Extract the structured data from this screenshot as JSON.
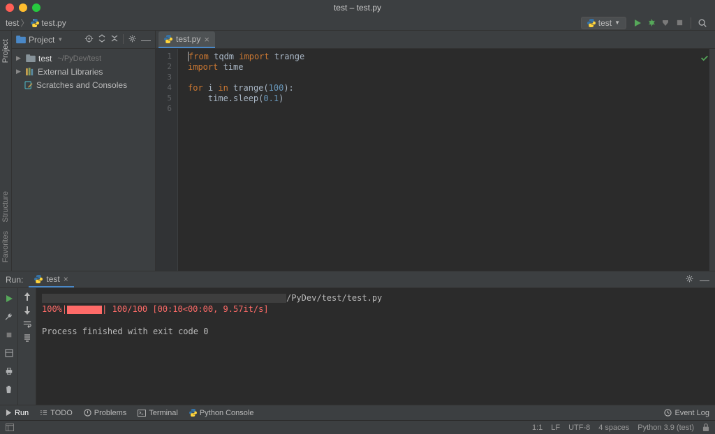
{
  "window": {
    "title": "test – test.py"
  },
  "breadcrumb": {
    "project": "test",
    "file": "test.py"
  },
  "run_config": {
    "name": "test"
  },
  "project_panel": {
    "title": "Project",
    "tree": {
      "root": "test",
      "root_path": "~/PyDev/test",
      "external": "External Libraries",
      "scratches": "Scratches and Consoles"
    }
  },
  "left_strip": {
    "project": "Project",
    "structure": "Structure",
    "favorites": "Favorites"
  },
  "editor": {
    "tab": "test.py",
    "lines": [
      "1",
      "2",
      "3",
      "4",
      "5",
      "6"
    ],
    "code": {
      "l1_from": "from",
      "l1_mod": " tqdm ",
      "l1_import": "import",
      "l1_name": " trange",
      "l2_import": "import",
      "l2_mod": " time",
      "l4_for": "for",
      "l4_var": " i ",
      "l4_in": "in",
      "l4_call": " trange(",
      "l4_num": "100",
      "l4_end": "):",
      "l5_indent": "    time.sleep(",
      "l5_num": "0.1",
      "l5_end": ")"
    }
  },
  "run": {
    "header_label": "Run:",
    "tab": "test",
    "path_suffix": "/PyDev/test/test.py",
    "progress_prefix": "100%|",
    "progress_stats": "| 100/100 [00:10<00:00,  9.57it/s]",
    "exit_text": "Process finished with exit code 0"
  },
  "bottom_tools": {
    "run": "Run",
    "todo": "TODO",
    "problems": "Problems",
    "terminal": "Terminal",
    "python_console": "Python Console",
    "event_log": "Event Log"
  },
  "status": {
    "caret": "1:1",
    "lf": "LF",
    "encoding": "UTF-8",
    "indent": "4 spaces",
    "interpreter": "Python 3.9 (test)"
  }
}
